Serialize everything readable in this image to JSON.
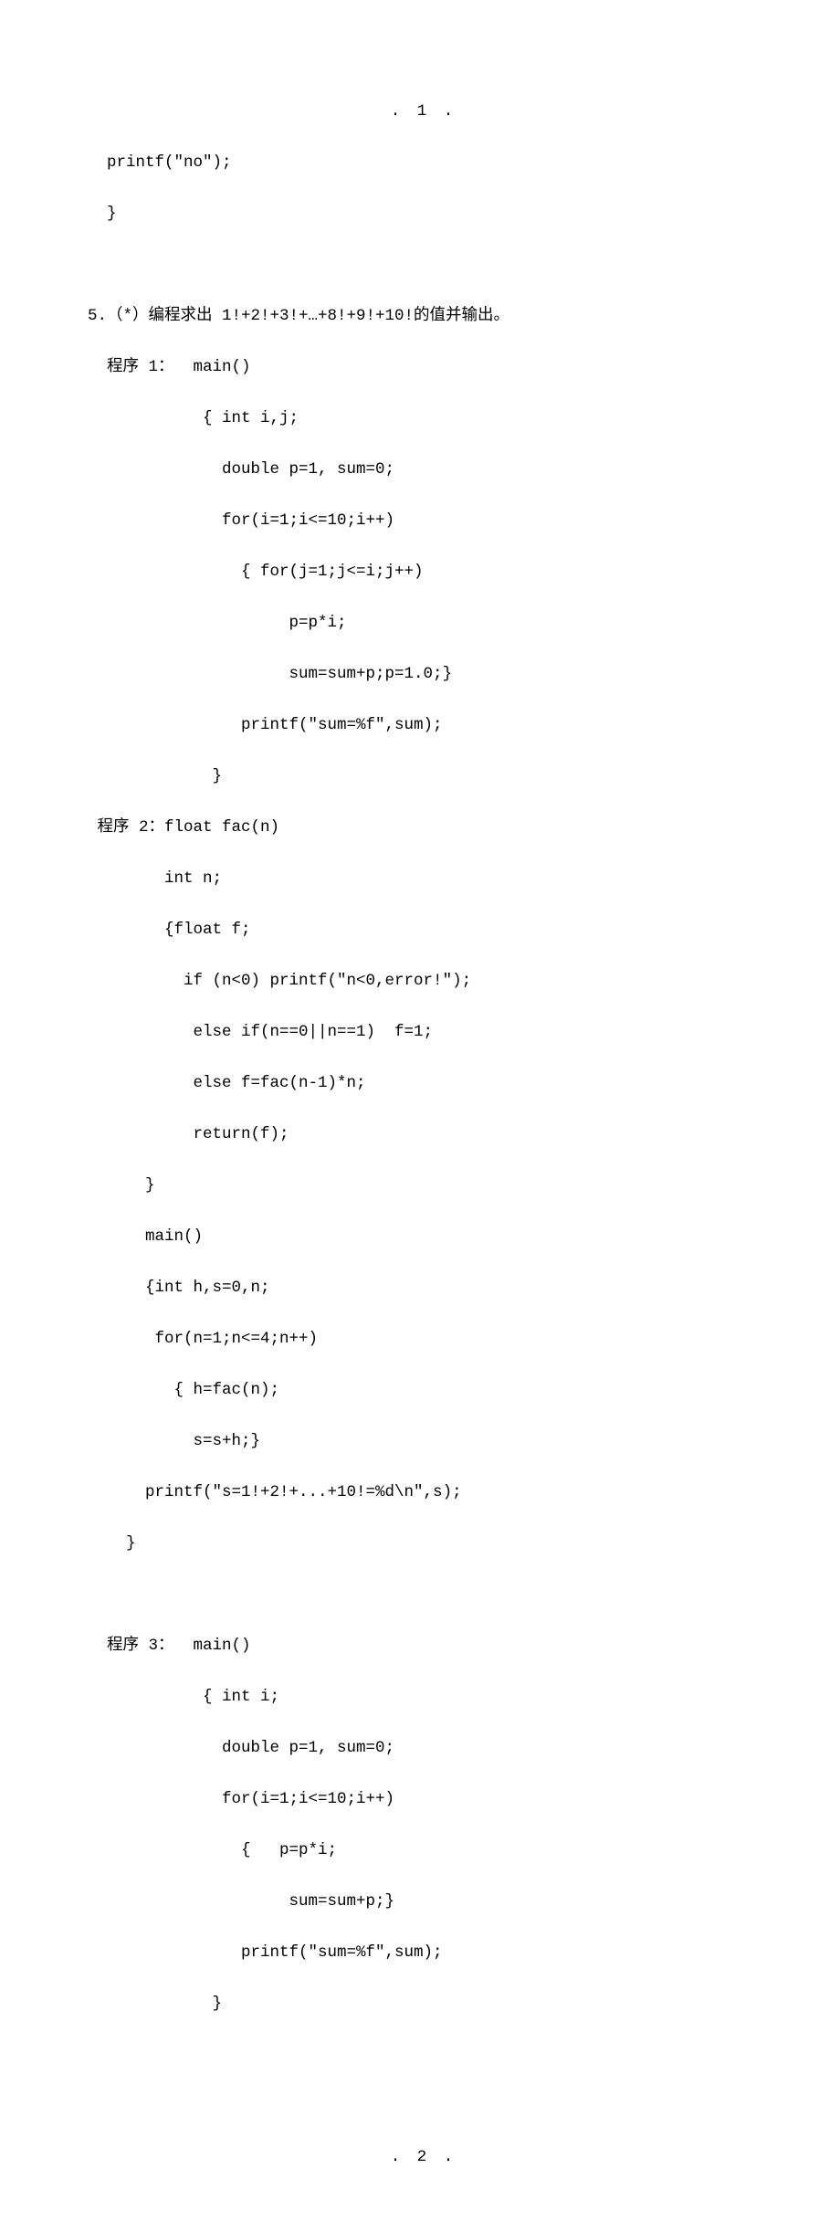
{
  "pageNum1": ". 1 .",
  "pageNum2": ". 2 .",
  "frag0_l0": "  printf(\"no\");",
  "frag0_l1": "  }",
  "q5_title": "5.（*）编程求出 1!+2!+3!+…+8!+9!+10!的值并输出。",
  "p1_label": "  程序 1：  main()",
  "p1_l0": "            { int i,j;",
  "p1_l1": "              double p=1, sum=0;",
  "p1_l2": "              for(i=1;i<=10;i++)",
  "p1_l3": "                { for(j=1;j<=i;j++)",
  "p1_l4": "                     p=p*i;",
  "p1_l5": "                     sum=sum+p;p=1.0;}",
  "p1_l6": "                printf(\"sum=%f\",sum);",
  "p1_l7": "             }",
  "p2_label": " 程序 2：float fac(n)",
  "p2_l0": "        int n;",
  "p2_l1": "        {float f;",
  "p2_l2": "          if (n<0) printf(\"n<0,error!\");",
  "p2_l3": "           else if(n==0||n==1)  f=1;",
  "p2_l4": "           else f=fac(n-1)*n;",
  "p2_l5": "           return(f);",
  "p2_l6": "      }",
  "p2_l7": "      main()",
  "p2_l8": "      {int h,s=0,n;",
  "p2_l9": "       for(n=1;n<=4;n++)",
  "p2_l10": "         { h=fac(n);",
  "p2_l11": "           s=s+h;}",
  "p2_l12": "      printf(\"s=1!+2!+...+10!=%d\\n\",s);",
  "p2_l13": "    }",
  "p3_label": "  程序 3：  main()",
  "p3_l0": "            { int i;",
  "p3_l1": "              double p=1, sum=0;",
  "p3_l2": "              for(i=1;i<=10;i++)",
  "p3_l3": "                {   p=p*i;",
  "p3_l4": "                     sum=sum+p;}",
  "p3_l5": "                printf(\"sum=%f\",sum);",
  "p3_l6": "             }"
}
